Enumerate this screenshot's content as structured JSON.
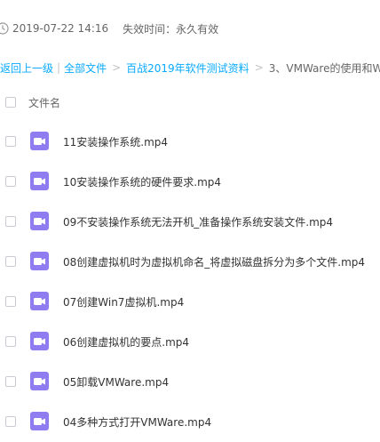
{
  "meta": {
    "date": "2019-07-22 14:16",
    "expiry": "失效时间：永久有效"
  },
  "breadcrumb": {
    "back": "返回上一级",
    "sep_pipe": "|",
    "all_files": "全部文件",
    "sep": ">",
    "folder": "百战2019年软件测试资料",
    "current": "3、VMWare的使用和Win"
  },
  "list_header": {
    "label": "文件名"
  },
  "colors": {
    "accent": "#09aaff",
    "video_icon": "#8e7cf0"
  },
  "files": [
    {
      "name": "11安装操作系统.mp4",
      "icon": "video-file-icon"
    },
    {
      "name": "10安装操作系统的硬件要求.mp4",
      "icon": "video-file-icon"
    },
    {
      "name": "09不安装操作系统无法开机_准备操作系统安装文件.mp4",
      "icon": "video-file-icon"
    },
    {
      "name": "08创建虚拟机时为虚拟机命名_将虚拟磁盘拆分为多个文件.mp4",
      "icon": "video-file-icon"
    },
    {
      "name": "07创建Win7虚拟机.mp4",
      "icon": "video-file-icon"
    },
    {
      "name": "06创建虚拟机的要点.mp4",
      "icon": "video-file-icon"
    },
    {
      "name": "05卸载VMWare.mp4",
      "icon": "video-file-icon"
    },
    {
      "name": "04多种方式打开VMWare.mp4",
      "icon": "video-file-icon"
    }
  ]
}
